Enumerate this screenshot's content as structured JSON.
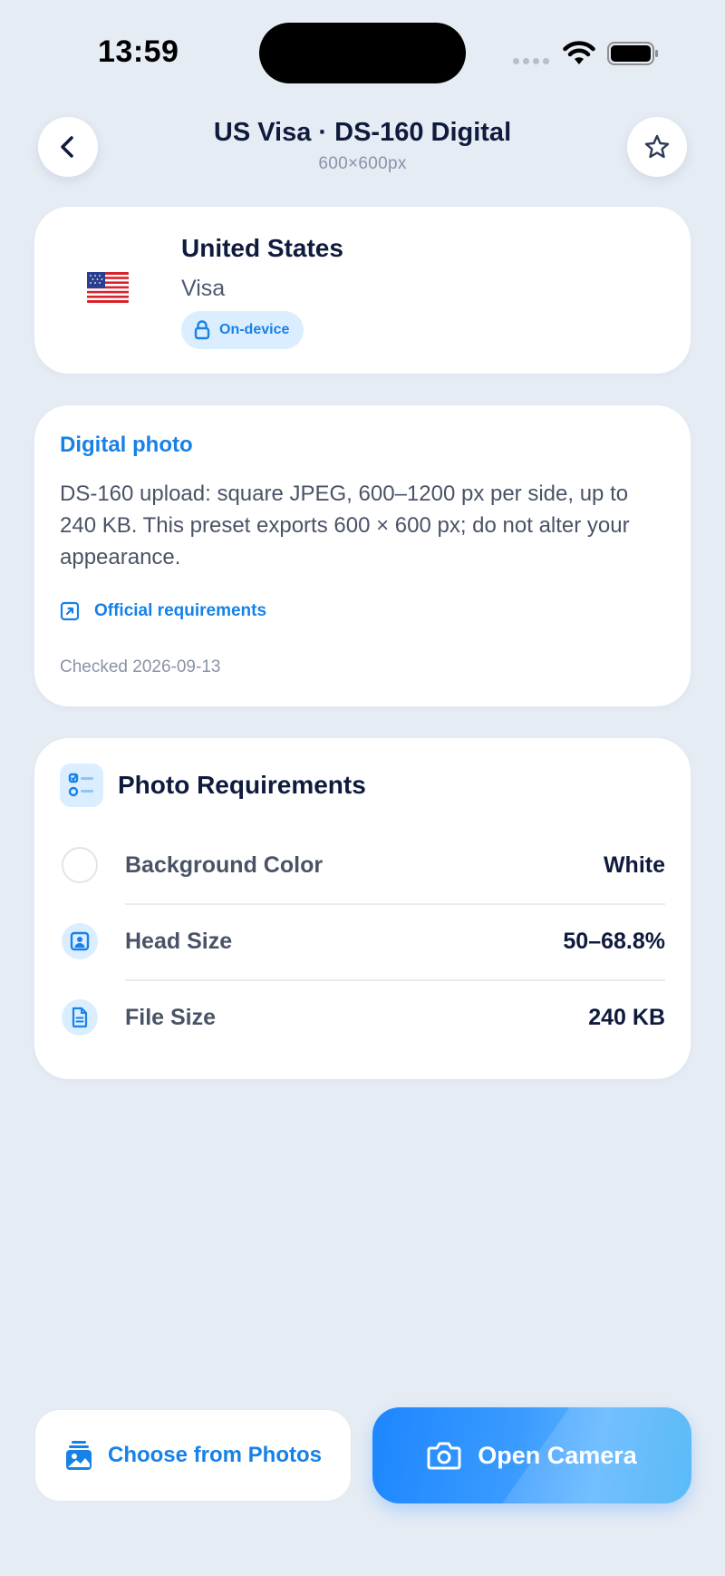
{
  "status_bar": {
    "time": "13:59"
  },
  "header": {
    "title": "US Visa · DS-160 Digital",
    "subtitle": "600×600px"
  },
  "country_card": {
    "country": "United States",
    "document_type": "Visa",
    "badge": "On-device"
  },
  "info_card": {
    "heading": "Digital photo",
    "body": "DS-160 upload: square JPEG, 600–1200 px per side, up to 240 KB. This preset exports 600 × 600 px; do not alter your appearance.",
    "link": "Official requirements",
    "checked": "Checked 2026-09-13"
  },
  "requirements": {
    "title": "Photo Requirements",
    "items": [
      {
        "label": "Background Color",
        "value": "White",
        "icon": "background-color-swatch"
      },
      {
        "label": "Head Size",
        "value": "50–68.8%",
        "icon": "portrait-icon"
      },
      {
        "label": "File Size",
        "value": "240 KB",
        "icon": "document-icon"
      }
    ]
  },
  "actions": {
    "choose_label": "Choose from Photos",
    "camera_label": "Open Camera"
  },
  "colors": {
    "accent": "#1781e8",
    "background": "#e6ecf4"
  }
}
